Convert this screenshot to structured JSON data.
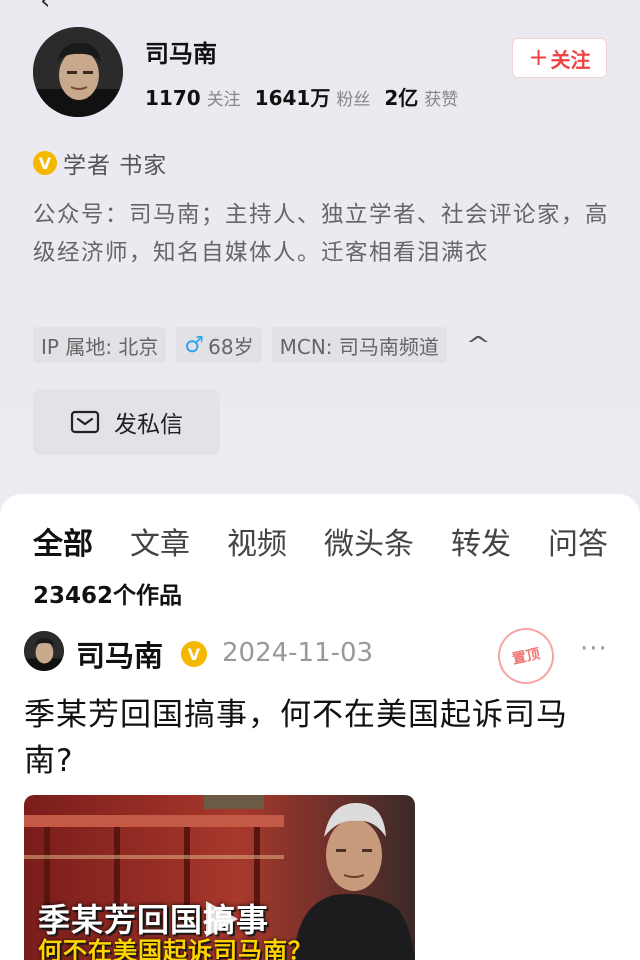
{
  "profile": {
    "name": "司马南",
    "following_count": "1170",
    "following_label": "关注",
    "followers_count": "1641万",
    "followers_label": "粉丝",
    "likes_count": "2亿",
    "likes_label": "获赞",
    "follow_button": "关注",
    "verification": "学者 书家",
    "bio": "公众号：司马南；主持人、独立学者、社会评论家，高级经济师，知名自媒体人。迁客相看泪满衣",
    "tags": {
      "ip": "IP 属地: 北京",
      "age": "68岁",
      "mcn": "MCN: 司马南频道"
    },
    "message_button": "发私信"
  },
  "tabs": [
    "全部",
    "文章",
    "视频",
    "微头条",
    "转发",
    "问答"
  ],
  "works_count": "23462个作品",
  "post": {
    "author": "司马南",
    "date": "2024-11-03",
    "pinned_label": "置顶",
    "title": "季某芳回国搞事，何不在美国起诉司马南?",
    "thumbnail_caption_line1": "季某芳回国搞事",
    "thumbnail_caption_line2": "何不在美国起诉司马南？"
  },
  "icons": {
    "verified": "verified-badge-icon",
    "male": "male-icon",
    "mail": "mail-icon",
    "collapse": "chevron-up-icon",
    "more": "more-dots-icon",
    "play": "play-icon"
  },
  "colors": {
    "accent": "#f04142",
    "verified": "#f5b800",
    "male": "#2da6f0"
  }
}
